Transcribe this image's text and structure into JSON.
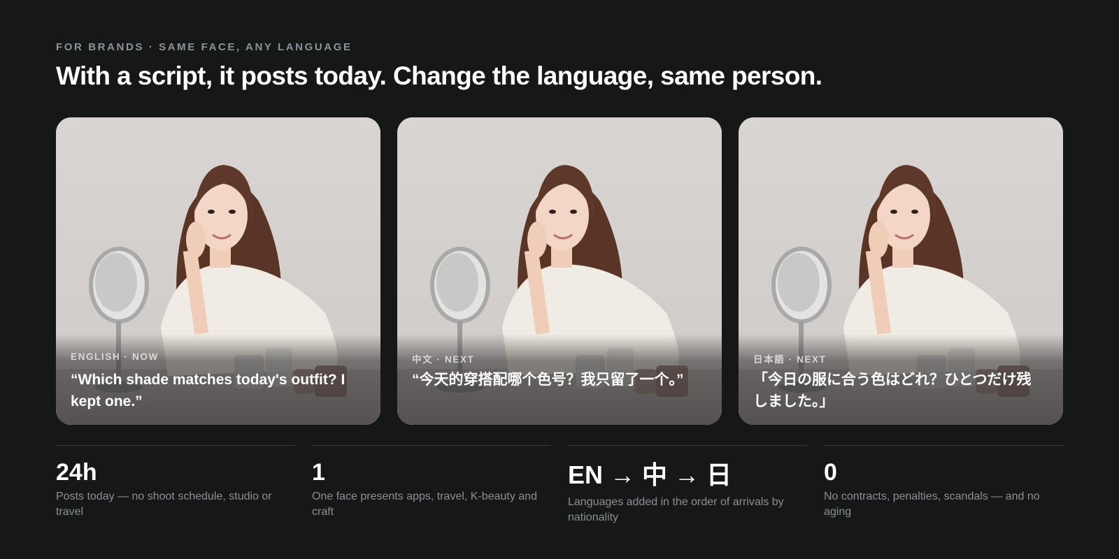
{
  "header": {
    "eyebrow": "FOR BRANDS · SAME FACE, ANY LANGUAGE",
    "headline": "With a script, it posts today. Change the language, same person."
  },
  "cards": [
    {
      "tag": "ENGLISH · NOW",
      "quote": "“Which shade matches today's outfit? I kept one.”"
    },
    {
      "tag": "中文 · NEXT",
      "quote": "“今天的穿搭配哪个色号？我只留了一个。”"
    },
    {
      "tag": "日本語 · NEXT",
      "quote": "「今日の服に合う色はどれ？ひとつだけ残しました。」"
    }
  ],
  "stats": [
    {
      "value": "24h",
      "desc": "Posts today — no shoot schedule, studio or travel"
    },
    {
      "value": "1",
      "desc": "One face presents apps, travel, K-beauty and craft"
    },
    {
      "value": "EN → 中 → 日",
      "desc": "Languages added in the order of arrivals by nationality"
    },
    {
      "value": "0",
      "desc": "No contracts, penalties, scandals — and no aging"
    }
  ],
  "colors": {
    "background": "#161717",
    "eyebrow": "#8d939a",
    "muted_text": "#8a9096",
    "divider": "#3a3c3e"
  }
}
